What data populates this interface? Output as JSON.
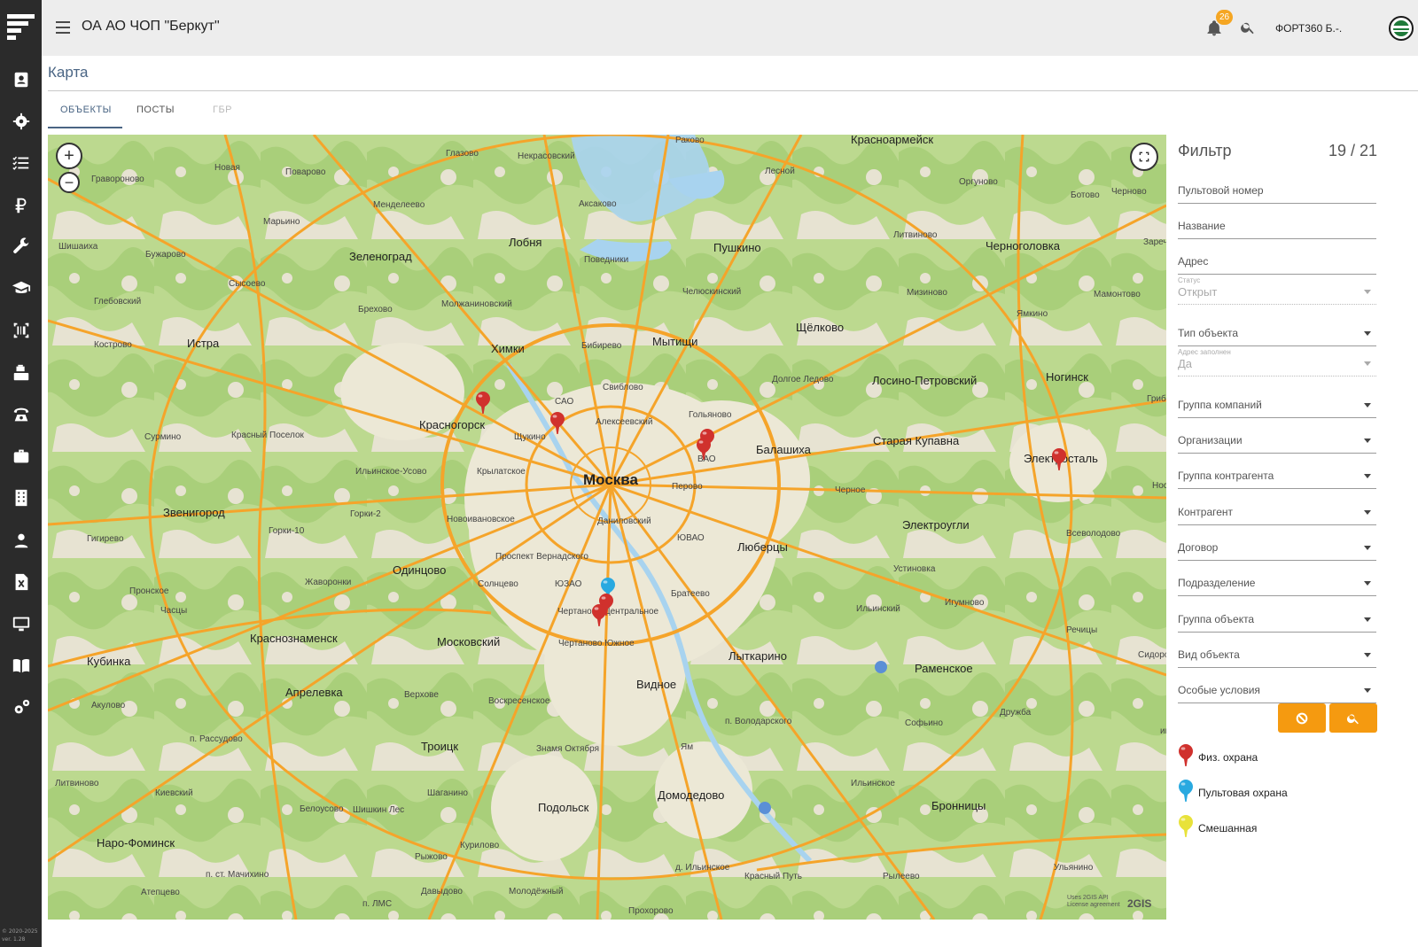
{
  "sidebar": {
    "items": [
      {
        "icon": "contact-card-icon"
      },
      {
        "icon": "gear-badge-icon"
      },
      {
        "icon": "checklist-icon"
      },
      {
        "icon": "ruble-icon"
      },
      {
        "icon": "wrench-icon"
      },
      {
        "icon": "graduation-cap-icon"
      },
      {
        "icon": "barcode-scan-icon"
      },
      {
        "icon": "cash-register-icon"
      },
      {
        "icon": "phone-icon"
      },
      {
        "icon": "briefcase-icon"
      },
      {
        "icon": "building-icon"
      },
      {
        "icon": "user-icon"
      },
      {
        "icon": "excel-file-icon"
      },
      {
        "icon": "monitor-icon"
      },
      {
        "icon": "book-icon"
      },
      {
        "icon": "settings-icon"
      }
    ],
    "copyright_line1": "© 2020-2025",
    "copyright_line2": "ver. 1.28"
  },
  "header": {
    "title": "ОА АО ЧОП \"Беркут\"",
    "notifications_count": "26",
    "user_name": "ФОРТ360 Б.-."
  },
  "page": {
    "title": "Карта",
    "tabs": [
      "Объекты",
      "Посты",
      "ГБР"
    ],
    "active_tab": "Объекты"
  },
  "map": {
    "provider": "2GIS",
    "attribution_line1": "Uses 2GIS API",
    "attribution_line2": "License agreement",
    "colors": {
      "land": "#e9e6d9",
      "forest": "#b9d88c",
      "water": "#a8d3ef",
      "road": "#f5a42a"
    },
    "places": [
      {
        "text": "Москва",
        "size": "xl"
      },
      {
        "text": "Красноармейск",
        "size": "l"
      },
      {
        "text": "Лобня",
        "size": "l"
      },
      {
        "text": "Пушкино",
        "size": "l"
      },
      {
        "text": "Зеленоград",
        "size": "l"
      },
      {
        "text": "Черноголовка",
        "size": "l"
      },
      {
        "text": "Истра",
        "size": "l"
      },
      {
        "text": "Химки",
        "size": "l"
      },
      {
        "text": "Мытищи",
        "size": "l"
      },
      {
        "text": "Щёлково",
        "size": "l"
      },
      {
        "text": "Красногорск",
        "size": "l"
      },
      {
        "text": "Лосино-Петровский",
        "size": "l"
      },
      {
        "text": "Ногинск",
        "size": "l"
      },
      {
        "text": "Балашиха",
        "size": "l"
      },
      {
        "text": "Старая Купавна",
        "size": "l"
      },
      {
        "text": "Электросталь",
        "size": "l"
      },
      {
        "text": "Звенигород",
        "size": "l"
      },
      {
        "text": "Электроугли",
        "size": "l"
      },
      {
        "text": "Люберцы",
        "size": "l"
      },
      {
        "text": "Одинцово",
        "size": "l"
      },
      {
        "text": "Краснознаменск",
        "size": "l"
      },
      {
        "text": "Московский",
        "size": "l"
      },
      {
        "text": "Лыткарино",
        "size": "l"
      },
      {
        "text": "Кубинка",
        "size": "l"
      },
      {
        "text": "Раменское",
        "size": "l"
      },
      {
        "text": "Видное",
        "size": "l"
      },
      {
        "text": "Апрелевка",
        "size": "l"
      },
      {
        "text": "Троицк",
        "size": "l"
      },
      {
        "text": "Домодедово",
        "size": "l"
      },
      {
        "text": "Подольск",
        "size": "l"
      },
      {
        "text": "Бронницы",
        "size": "l"
      },
      {
        "text": "Наро-Фоминск",
        "size": "l"
      },
      {
        "text": "Раково",
        "size": "s"
      },
      {
        "text": "Некрасовский",
        "size": "s"
      },
      {
        "text": "Глазово",
        "size": "s"
      },
      {
        "text": "Новая",
        "size": "s"
      },
      {
        "text": "Гравороново",
        "size": "s"
      },
      {
        "text": "Поварово",
        "size": "s"
      },
      {
        "text": "Менделеево",
        "size": "s"
      },
      {
        "text": "Аксаково",
        "size": "s"
      },
      {
        "text": "Лесной",
        "size": "s"
      },
      {
        "text": "Оргуново",
        "size": "s"
      },
      {
        "text": "Ботово",
        "size": "s"
      },
      {
        "text": "Черново",
        "size": "s"
      },
      {
        "text": "Марьино",
        "size": "s"
      },
      {
        "text": "Шишаиха",
        "size": "s"
      },
      {
        "text": "Бужарово",
        "size": "s"
      },
      {
        "text": "Поведники",
        "size": "s"
      },
      {
        "text": "Литвиново",
        "size": "s"
      },
      {
        "text": "Заречье",
        "size": "s"
      },
      {
        "text": "Сысоево",
        "size": "s"
      },
      {
        "text": "Глебовский",
        "size": "s"
      },
      {
        "text": "Брехово",
        "size": "s"
      },
      {
        "text": "Молжаниновский",
        "size": "s"
      },
      {
        "text": "Челюскинский",
        "size": "s"
      },
      {
        "text": "Мизиново",
        "size": "s"
      },
      {
        "text": "Мамонтово",
        "size": "s"
      },
      {
        "text": "Кострово",
        "size": "s"
      },
      {
        "text": "Ямкино",
        "size": "s"
      },
      {
        "text": "Бибирево",
        "size": "s"
      },
      {
        "text": "Свиблово",
        "size": "s"
      },
      {
        "text": "Долгое Ледово",
        "size": "s"
      },
      {
        "text": "САО",
        "size": "s"
      },
      {
        "text": "Гольяново",
        "size": "s"
      },
      {
        "text": "Грибан",
        "size": "s"
      },
      {
        "text": "Алексеевский",
        "size": "s"
      },
      {
        "text": "Сурмино",
        "size": "s"
      },
      {
        "text": "Красный Поселок",
        "size": "s"
      },
      {
        "text": "Щукино",
        "size": "s"
      },
      {
        "text": "ВАО",
        "size": "s"
      },
      {
        "text": "Ильинское-Усово",
        "size": "s"
      },
      {
        "text": "Крылатское",
        "size": "s"
      },
      {
        "text": "Перово",
        "size": "s"
      },
      {
        "text": "Черное",
        "size": "s"
      },
      {
        "text": "Горки-2",
        "size": "s"
      },
      {
        "text": "Новоивановское",
        "size": "s"
      },
      {
        "text": "Даниловский",
        "size": "s"
      },
      {
        "text": "Горки-10",
        "size": "s"
      },
      {
        "text": "Гигирево",
        "size": "s"
      },
      {
        "text": "ЮВАО",
        "size": "s"
      },
      {
        "text": "Всеволодово",
        "size": "s"
      },
      {
        "text": "Проспект Вернадского",
        "size": "s"
      },
      {
        "text": "Устиновка",
        "size": "s"
      },
      {
        "text": "Жаворонки",
        "size": "s"
      },
      {
        "text": "Солнцево",
        "size": "s"
      },
      {
        "text": "ЮЗАО",
        "size": "s"
      },
      {
        "text": "Братеево",
        "size": "s"
      },
      {
        "text": "Игумново",
        "size": "s"
      },
      {
        "text": "Пронское",
        "size": "s"
      },
      {
        "text": "Часцы",
        "size": "s"
      },
      {
        "text": "Чертаново Центральное",
        "size": "s"
      },
      {
        "text": "Ильинский",
        "size": "s"
      },
      {
        "text": "Речицы",
        "size": "s"
      },
      {
        "text": "Чертаново Южное",
        "size": "s"
      },
      {
        "text": "Сидорово",
        "size": "s"
      },
      {
        "text": "Акулово",
        "size": "s"
      },
      {
        "text": "Верхове",
        "size": "s"
      },
      {
        "text": "Воскресенское",
        "size": "s"
      },
      {
        "text": "Дружба",
        "size": "s"
      },
      {
        "text": "п. Рассудово",
        "size": "s"
      },
      {
        "text": "п. Володарского",
        "size": "s"
      },
      {
        "text": "Софьино",
        "size": "s"
      },
      {
        "text": "Знамя Октября",
        "size": "s"
      },
      {
        "text": "Ям",
        "size": "s"
      },
      {
        "text": "Литвиново",
        "size": "s"
      },
      {
        "text": "Ильинское",
        "size": "s"
      },
      {
        "text": "Киевский",
        "size": "s"
      },
      {
        "text": "Шаганино",
        "size": "s"
      },
      {
        "text": "Белоусово",
        "size": "s"
      },
      {
        "text": "Шишкин Лес",
        "size": "s"
      },
      {
        "text": "Курилово",
        "size": "s"
      },
      {
        "text": "Рыжово",
        "size": "s"
      },
      {
        "text": "д. Ильинское",
        "size": "s"
      },
      {
        "text": "Ульянино",
        "size": "s"
      },
      {
        "text": "п. ст. Мачихино",
        "size": "s"
      },
      {
        "text": "Красный Путь",
        "size": "s"
      },
      {
        "text": "Рылеево",
        "size": "s"
      },
      {
        "text": "Атепцево",
        "size": "s"
      },
      {
        "text": "Давыдово",
        "size": "s"
      },
      {
        "text": "Молодёжный",
        "size": "s"
      },
      {
        "text": "п. ЛМС",
        "size": "s"
      },
      {
        "text": "Прохорово",
        "size": "s"
      },
      {
        "text": "Носо",
        "size": "s"
      },
      {
        "text": "им. Л",
        "size": "s"
      }
    ],
    "markers": [
      {
        "type": "phys",
        "color": "#d0312d"
      },
      {
        "type": "phys",
        "color": "#d0312d"
      },
      {
        "type": "phys",
        "color": "#d0312d"
      },
      {
        "type": "phys",
        "color": "#d0312d"
      },
      {
        "type": "phys",
        "color": "#d0312d"
      },
      {
        "type": "console",
        "color": "#29a9e0"
      },
      {
        "type": "phys",
        "color": "#d0312d"
      },
      {
        "type": "phys",
        "color": "#d0312d"
      }
    ]
  },
  "filter": {
    "title": "Фильтр",
    "count": "19 / 21",
    "fields": [
      {
        "label": "Пультовой номер",
        "type": "text"
      },
      {
        "label": "Название",
        "type": "text"
      },
      {
        "label": "Адрес",
        "type": "text"
      },
      {
        "label": "Статус",
        "value": "Открыт",
        "type": "select-disabled"
      },
      {
        "label": "Тип объекта",
        "type": "select"
      },
      {
        "label": "Адрес заполнен",
        "value": "Да",
        "type": "select-disabled"
      },
      {
        "label": "Группа компаний",
        "type": "select"
      },
      {
        "label": "Организации",
        "type": "select"
      },
      {
        "label": "Группа контрагента",
        "type": "select"
      },
      {
        "label": "Контрагент",
        "type": "select"
      },
      {
        "label": "Договор",
        "type": "select"
      },
      {
        "label": "Подразделение",
        "type": "select"
      },
      {
        "label": "Группа объекта",
        "type": "select"
      },
      {
        "label": "Вид объекта",
        "type": "select"
      },
      {
        "label": "Особые условия",
        "type": "select"
      }
    ],
    "buttons": {
      "reset_icon": "block-icon",
      "search_icon": "search-icon",
      "color": "#f59a10"
    },
    "legend": [
      {
        "label": "Физ. охрана",
        "color": "#d0312d"
      },
      {
        "label": "Пультовая охрана",
        "color": "#29a9e0"
      },
      {
        "label": "Смешанная",
        "color": "#e8e23a"
      }
    ]
  }
}
